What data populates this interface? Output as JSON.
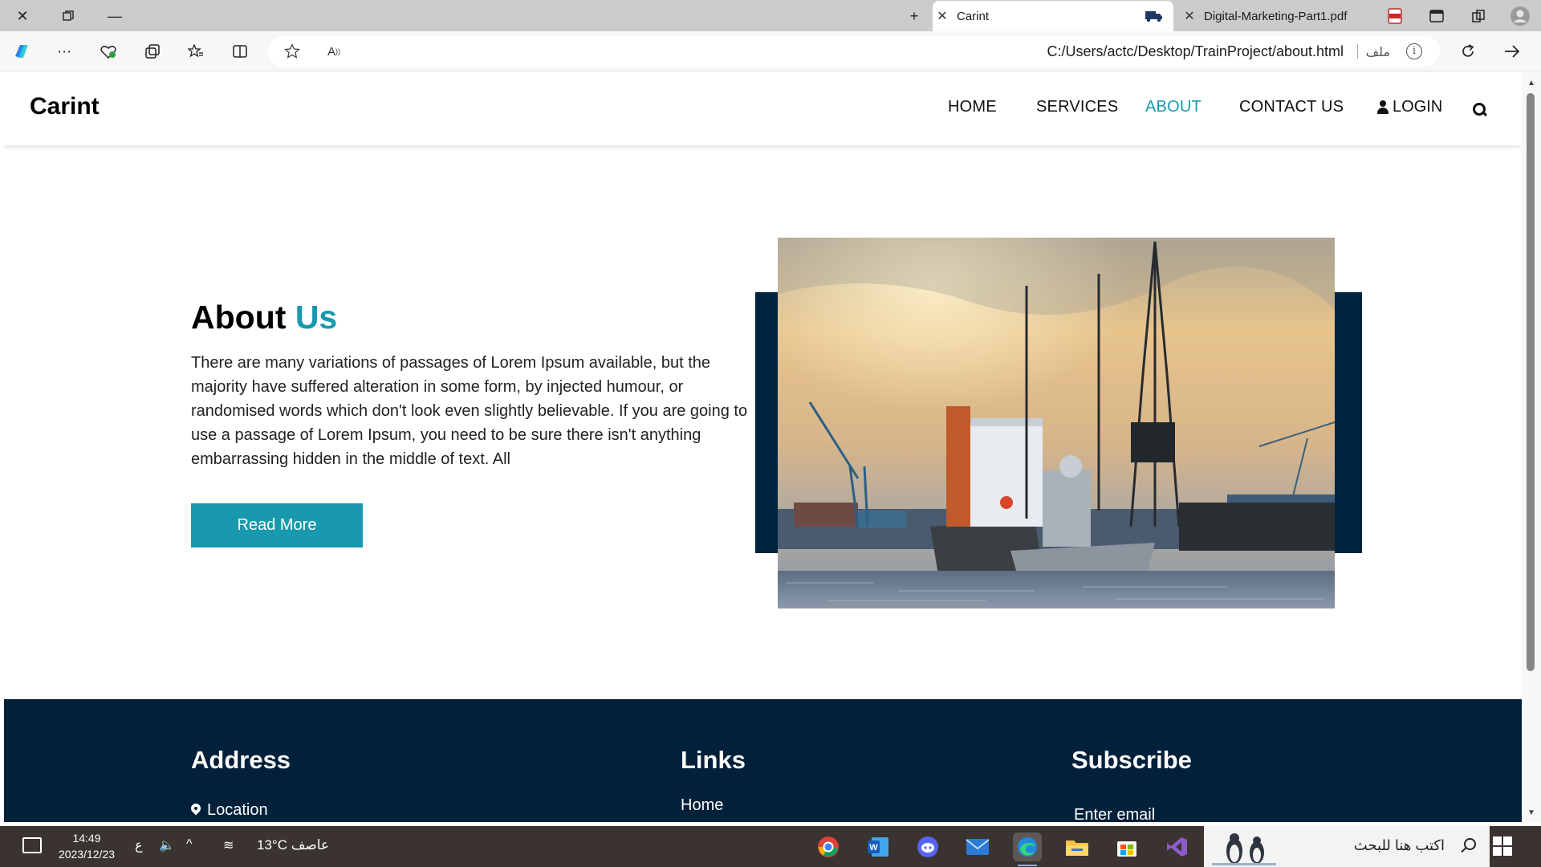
{
  "browser": {
    "tabs": [
      {
        "title": "",
        "kind": "new-tab"
      },
      {
        "title": "Carint",
        "active": true
      },
      {
        "title": "Digital-Marketing-Part1.pdf",
        "active": false
      }
    ],
    "address": {
      "url": "C:/Users/actc/Desktop/TrainProject/about.html",
      "file_label": "ملف"
    }
  },
  "site": {
    "logo": "Carint",
    "nav": {
      "home": "HOME",
      "services": "SERVICES",
      "about": "ABOUT",
      "contact": "CONTACT US",
      "login": "LOGIN"
    },
    "about": {
      "title_main": "About",
      "title_accent": "Us",
      "body": "There are many variations of passages of Lorem Ipsum available, but the majority have suffered alteration in some form, by injected humour, or randomised words which don't look even slightly believable. If you are going to use a passage of Lorem Ipsum, you need to be sure there isn't anything embarrassing hidden in the middle of text. All",
      "button": "Read More"
    },
    "footer": {
      "address_heading": "Address",
      "location": "Location",
      "links_heading": "Links",
      "link_home": "Home",
      "subscribe_heading": "Subscribe",
      "email_placeholder": "Enter email"
    }
  },
  "taskbar": {
    "time": "14:49",
    "date": "2023/12/23",
    "lang": "ع",
    "temperature": "13°C",
    "weather": "عاصف",
    "search_placeholder": "اكتب هنا للبحث",
    "apps": [
      "chrome",
      "word",
      "discord",
      "mail",
      "edge",
      "file-explorer",
      "store",
      "visual-studio"
    ]
  },
  "colors": {
    "accent": "#1899ae",
    "navy": "#01233d",
    "footer": "#01203a"
  }
}
